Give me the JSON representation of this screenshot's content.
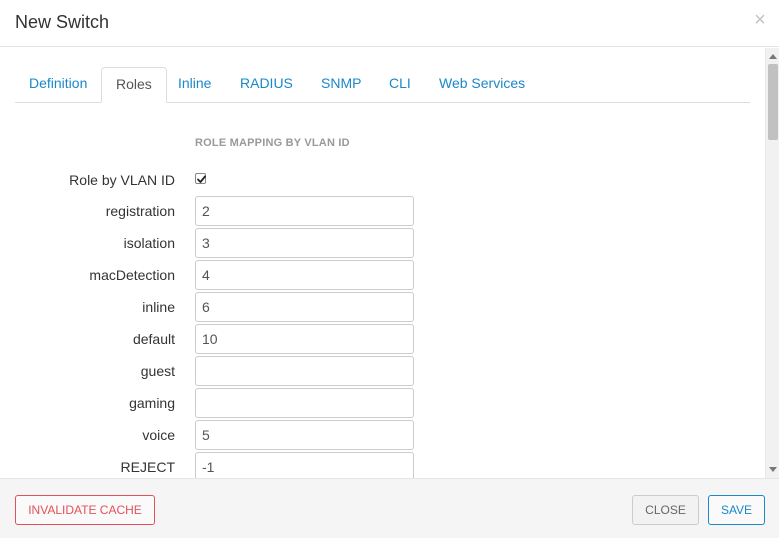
{
  "dialog": {
    "title": "New Switch",
    "close_glyph": "×"
  },
  "tabs": [
    {
      "label": "Definition",
      "active": false
    },
    {
      "label": "Roles",
      "active": true
    },
    {
      "label": "Inline",
      "active": false
    },
    {
      "label": "RADIUS",
      "active": false
    },
    {
      "label": "SNMP",
      "active": false
    },
    {
      "label": "CLI",
      "active": false
    },
    {
      "label": "Web Services",
      "active": false
    }
  ],
  "section": {
    "title": "ROLE MAPPING BY VLAN ID"
  },
  "role_by_vlan": {
    "label": "Role by VLAN ID",
    "checked": true
  },
  "fields": [
    {
      "label": "registration",
      "value": "2"
    },
    {
      "label": "isolation",
      "value": "3"
    },
    {
      "label": "macDetection",
      "value": "4"
    },
    {
      "label": "inline",
      "value": "6"
    },
    {
      "label": "default",
      "value": "10"
    },
    {
      "label": "guest",
      "value": ""
    },
    {
      "label": "gaming",
      "value": ""
    },
    {
      "label": "voice",
      "value": "5"
    },
    {
      "label": "REJECT",
      "value": "-1"
    }
  ],
  "footer": {
    "invalidate_label": "INVALIDATE CACHE",
    "close_label": "CLOSE",
    "save_label": "SAVE"
  },
  "colors": {
    "link": "#1a88c9",
    "danger": "#e0525a",
    "muted": "#999999"
  }
}
